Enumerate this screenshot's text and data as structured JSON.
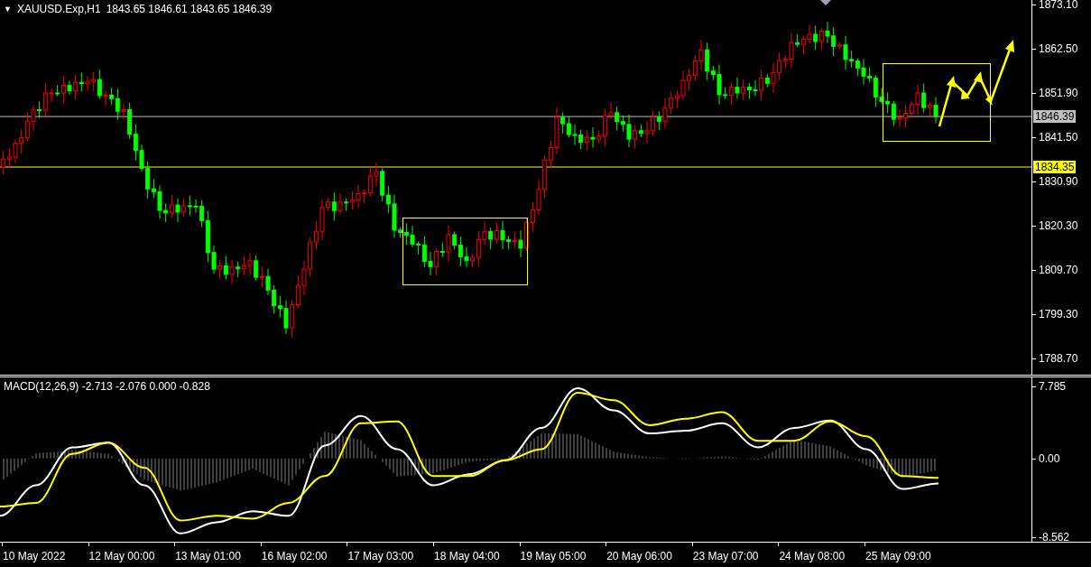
{
  "symbol_header": {
    "menu_glyph": "▼",
    "symbol": "XAUUSD.Exp,H1",
    "ohlc": [
      "1843.65",
      "1846.61",
      "1843.65",
      "1846.39"
    ]
  },
  "price_chart": {
    "price_scale": [
      "1873.10",
      "1862.50",
      "1851.90",
      "1841.50",
      "1830.90",
      "1820.30",
      "1809.70",
      "1799.30",
      "1788.70"
    ],
    "price_lines": [
      {
        "label": "1846.39",
        "color": "#c0c0c0"
      },
      {
        "label": "1834.35",
        "color": "#ffff00"
      }
    ]
  },
  "macd": {
    "label": "MACD(12,26,9) -2.713 -2.076 0.000 -0.828",
    "scale": [
      "7.785",
      "0.00",
      "-8.562"
    ]
  },
  "time_axis": [
    "10 May 2022",
    "12 May 00:00",
    "13 May 01:00",
    "16 May 02:00",
    "17 May 03:00",
    "18 May 04:00",
    "19 May 05:00",
    "20 May 06:00",
    "23 May 07:00",
    "24 May 08:00",
    "25 May 09:00"
  ]
}
